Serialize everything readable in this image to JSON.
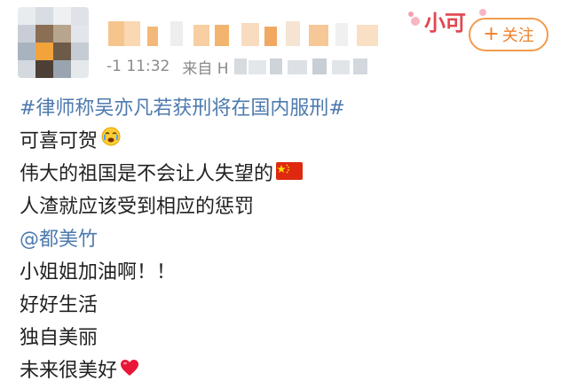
{
  "header": {
    "time": "-1 11:32",
    "from_label": "来自 H",
    "follow_label": "关注",
    "badge_text": "小可"
  },
  "post": {
    "topic": "#律师称吴亦凡若获刑将在国内服刑#",
    "lines": [
      "可喜可贺",
      "伟大的祖国是不会让人失望的",
      "人渣就应该受到相应的惩罚"
    ],
    "mention": "@都美竹",
    "closing_lines": [
      "小姐姐加油啊！！",
      "好好生活",
      "独自美丽",
      "未来很美好"
    ]
  },
  "colors": {
    "link": "#4d7aae",
    "follow": "#f0812b",
    "meta": "#8a8a8a",
    "text": "#222222"
  },
  "icons": [
    "crying-face-icon",
    "china-flag-icon",
    "red-heart-icon",
    "plus-icon"
  ]
}
